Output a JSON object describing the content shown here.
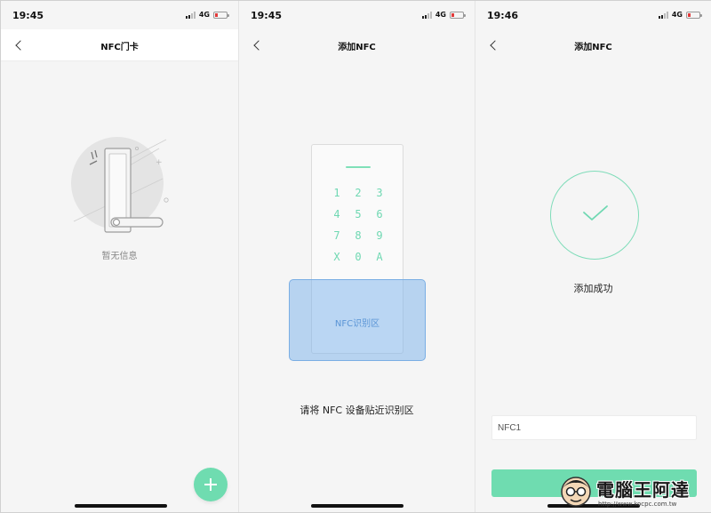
{
  "screens": [
    {
      "time": "19:45",
      "network": "4G",
      "title": "NFC门卡",
      "empty_text": "暂无信息"
    },
    {
      "time": "19:45",
      "network": "4G",
      "title": "添加NFC",
      "keypad": [
        "1",
        "2",
        "3",
        "4",
        "5",
        "6",
        "7",
        "8",
        "9",
        "X",
        "0",
        "A"
      ],
      "nfc_zone_label": "NFC识别区",
      "hint": "请将 NFC 设备贴近识别区"
    },
    {
      "time": "19:46",
      "network": "4G",
      "title": "添加NFC",
      "success_text": "添加成功",
      "name_value": "NFC1",
      "confirm_label": ""
    }
  ],
  "watermark": {
    "title": "電腦王阿達",
    "url": "http://www.kocpc.com.tw"
  },
  "colors": {
    "accent": "#6fdcb0",
    "nfc_zone": "#7ab2ec",
    "battery_low": "#e23b3b"
  }
}
